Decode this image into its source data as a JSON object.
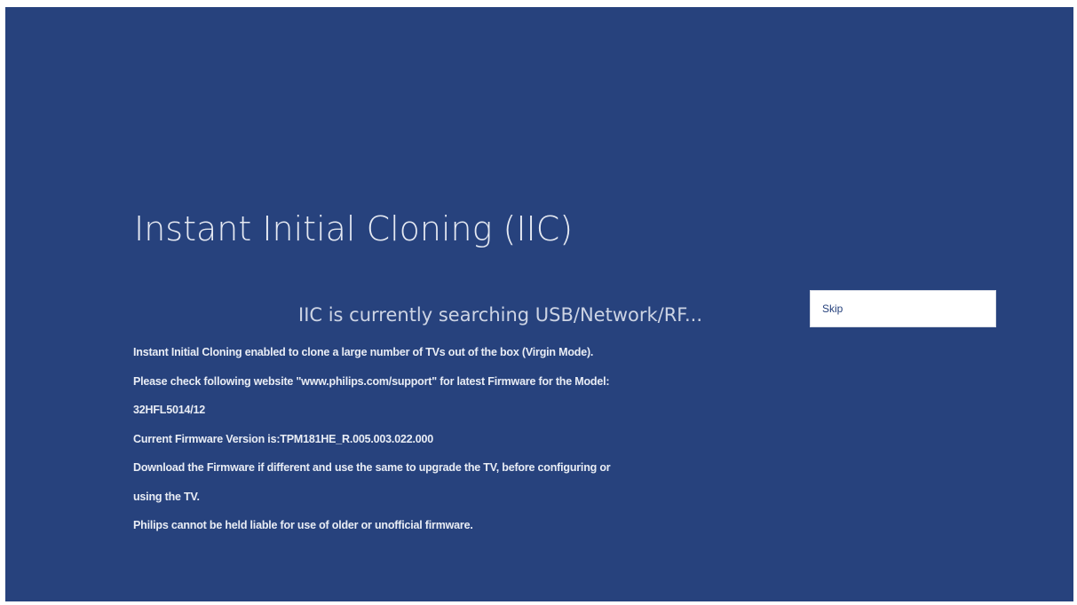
{
  "screen": {
    "title": "Instant Initial Cloning (IIC)",
    "status": "IIC is currently searching USB/Network/RF...",
    "skip_label": "Skip",
    "info_lines": [
      "Instant Initial Cloning enabled to clone a large number of TVs out of the box (Virgin Mode).",
      "Please check following website \"www.philips.com/support\" for latest Firmware for the Model:",
      "32HFL5014/12",
      "Current Firmware Version is:TPM181HE_R.005.003.022.000",
      "Download the Firmware if different and use the same to upgrade the TV, before configuring or",
      "using the TV.",
      "Philips cannot be held liable for use of older or unofficial firmware."
    ]
  },
  "colors": {
    "background": "#27427d",
    "text": "#e9edf5"
  }
}
